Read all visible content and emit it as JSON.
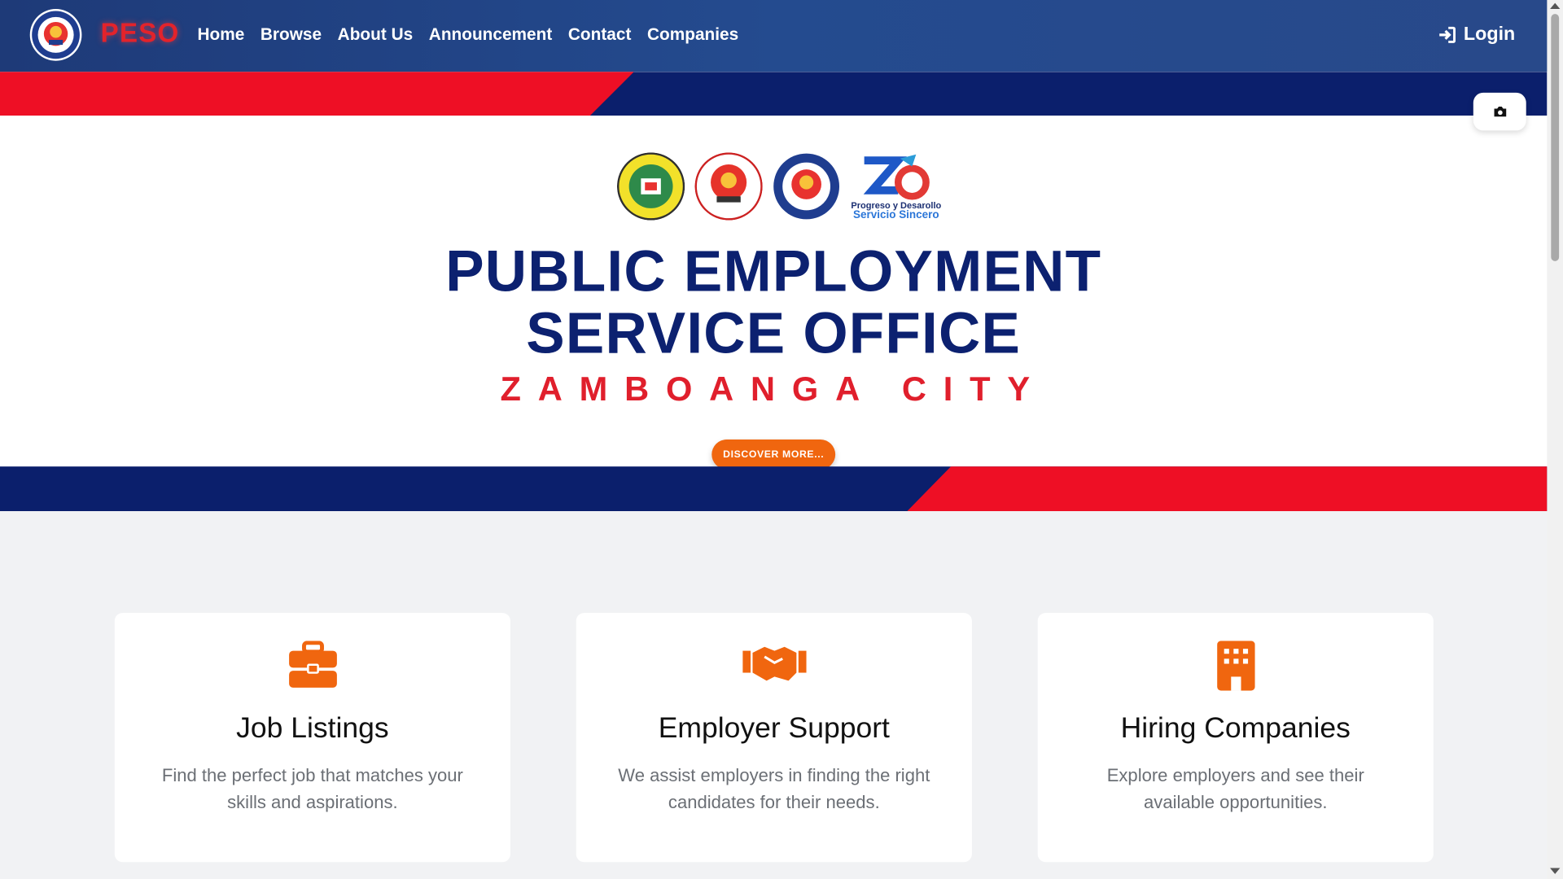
{
  "nav": {
    "brand": "PESO",
    "links": [
      "Home",
      "Browse",
      "About Us",
      "Announcement",
      "Contact",
      "Companies"
    ],
    "login": "Login"
  },
  "hero": {
    "title_line1": "PUBLIC EMPLOYMENT",
    "title_line2": "SERVICE OFFICE",
    "subtitle": "ZAMBOANGA CITY",
    "cta": "DISCOVER MORE...",
    "tagline_line1": "Progreso y Desarollo",
    "tagline_line2": "Servicio Sincero"
  },
  "cards": [
    {
      "title": "Job Listings",
      "text": "Find the perfect job that matches your skills and aspirations.",
      "icon": "briefcase-icon"
    },
    {
      "title": "Employer Support",
      "text": "We assist employers in finding the right candidates for their needs.",
      "icon": "handshake-icon"
    },
    {
      "title": "Hiring Companies",
      "text": "Explore employers and see their available opportunities.",
      "icon": "building-icon"
    }
  ],
  "colors": {
    "navy": "#0c2170",
    "red": "#e01f2c",
    "orange": "#f0660f"
  }
}
